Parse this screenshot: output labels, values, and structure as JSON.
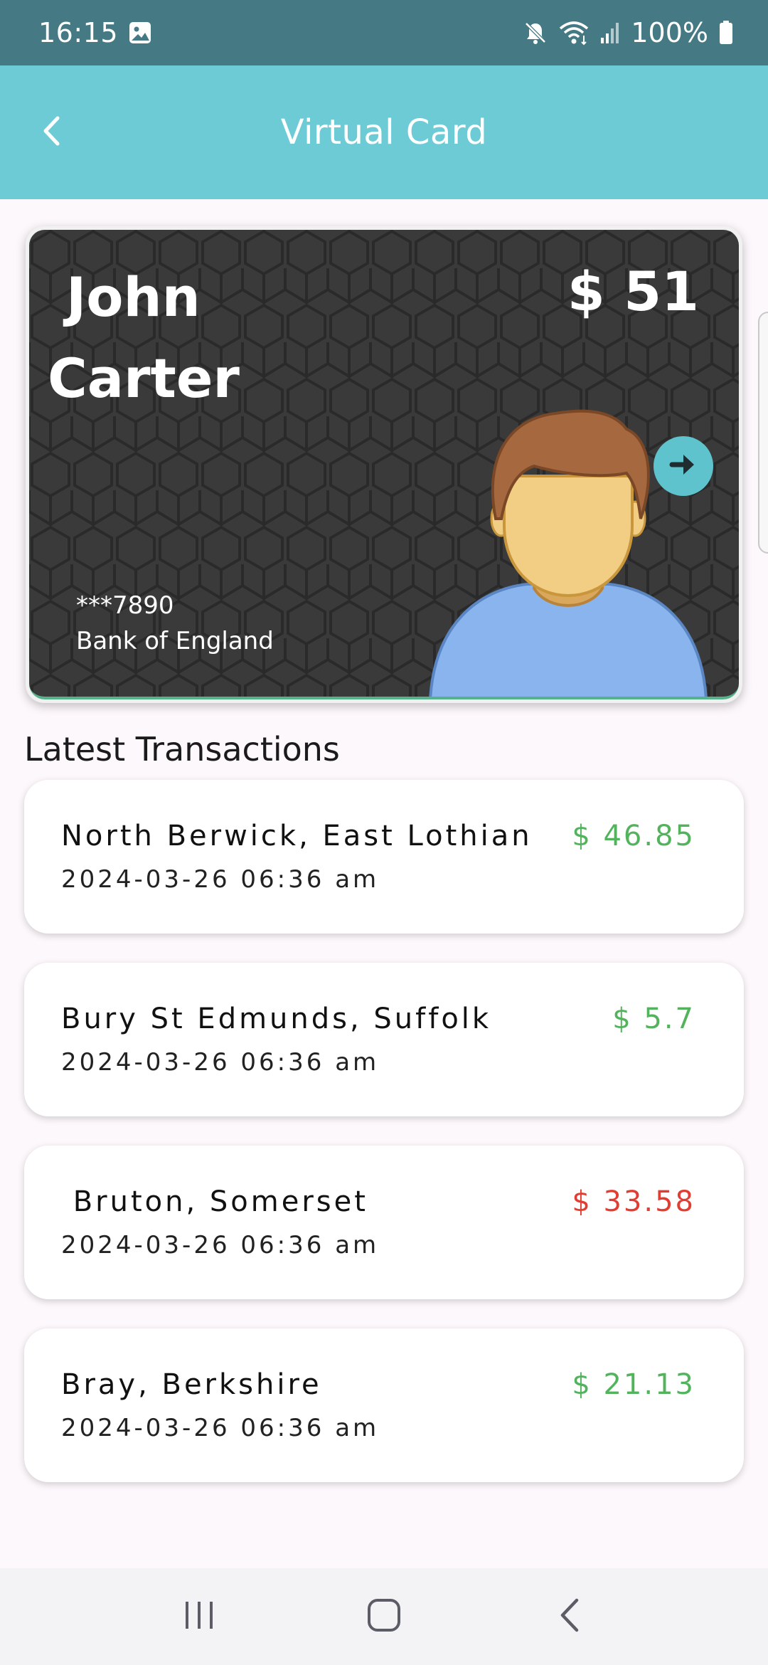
{
  "status_bar": {
    "time": "16:15",
    "battery": "100%",
    "icons": [
      "image-icon",
      "mute-icon",
      "wifi-icon",
      "signal-icon",
      "battery-icon"
    ]
  },
  "app_bar": {
    "title": "Virtual Card",
    "back_icon": "chevron-left-icon"
  },
  "card": {
    "holder_first": "John",
    "holder_last": "Carter",
    "balance": "$ 51",
    "number_masked": "***7890",
    "bank": "Bank of England",
    "go_icon": "arrow-right-icon",
    "avatar_icon": "person-avatar-icon"
  },
  "transactions": {
    "title": "Latest Transactions",
    "items": [
      {
        "place": "North Berwick, East Lothian",
        "date": "2024-03-26 06:36 am",
        "amount": "$ 46.85",
        "status": "credit"
      },
      {
        "place": "Bury St Edmunds, Suffolk",
        "date": "2024-03-26 06:36 am",
        "amount": "$ 5.7",
        "status": "credit"
      },
      {
        "place": " Bruton, Somerset",
        "date": "2024-03-26 06:36 am",
        "amount": "$ 33.58",
        "status": "debit"
      },
      {
        "place": "Bray, Berkshire",
        "date": "2024-03-26 06:36 am",
        "amount": "$ 21.13",
        "status": "credit"
      }
    ]
  },
  "nav_bar": {
    "icons": [
      "recent-apps-icon",
      "home-icon",
      "back-icon"
    ]
  },
  "colors": {
    "status_bar": "#457a84",
    "app_bar": "#6dcbd6",
    "card_bg": "#3a3a3a",
    "accent": "#5ec3cc",
    "credit": "#52b35c",
    "debit": "#e23d33"
  }
}
